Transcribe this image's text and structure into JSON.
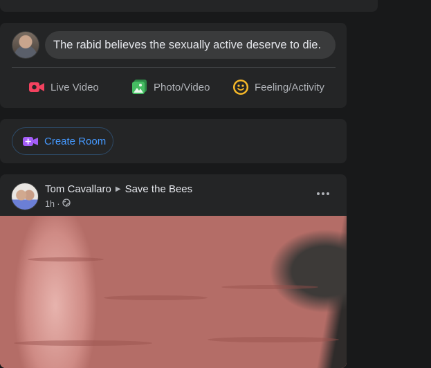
{
  "composer": {
    "status_text": "The rabid believes the sexually active deserve to die.",
    "actions": [
      {
        "label": "Live Video",
        "icon": "live-video-icon",
        "color": "#f3425f"
      },
      {
        "label": "Photo/Video",
        "icon": "photo-video-icon",
        "color": "#45bd62"
      },
      {
        "label": "Feeling/Activity",
        "icon": "feeling-activity-icon",
        "color": "#f7b928"
      }
    ]
  },
  "room": {
    "label": "Create Room",
    "icon": "create-room-icon",
    "color": "#a35df7"
  },
  "post": {
    "author": "Tom Cavallaro",
    "group": "Save the Bees",
    "time": "1h",
    "privacy_icon": "globe-icon",
    "more_icon": "more-options-icon"
  },
  "colors": {
    "background": "#18191a",
    "card": "#242526",
    "input": "#3a3b3c",
    "link": "#4599ff"
  }
}
